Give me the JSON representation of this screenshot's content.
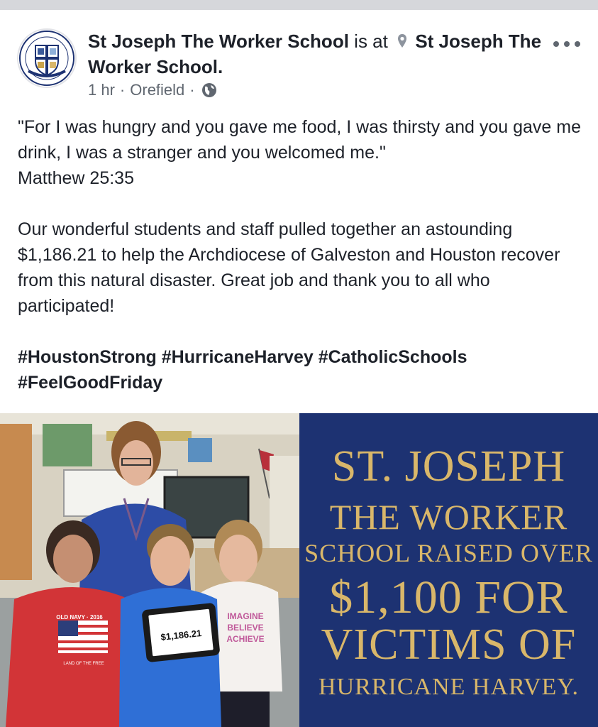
{
  "post": {
    "page_name": "St Joseph The Worker School",
    "checkin_text": "is at",
    "location_name": "St Joseph The Worker School.",
    "time": "1 hr",
    "place": "Orefield",
    "separator": "·",
    "body": {
      "quote": "\"For I was hungry and you gave me food, I was thirsty and you gave me drink, I was a stranger and you welcomed me.\"",
      "citation": "Matthew 25:35",
      "paragraph": "Our wonderful students and staff pulled together an astounding $1,186.21 to help the Archdiocese of Galveston and Houston recover from this natural disaster. Great job and thank you to all who participated!",
      "hashtags": "#HoustonStrong #HurricaneHarvey #CatholicSchools #FeelGoodFriday"
    },
    "icons": {
      "avatar": "school-crest",
      "location": "map-pin-icon",
      "privacy": "globe-icon",
      "menu": "more-options-icon"
    }
  },
  "photo": {
    "tablet_amount": "$1,186.21",
    "shirt_text_left": "OLD NAVY · 2016",
    "shirt_text_left_bottom": "LAND OF THE FREE",
    "shirt_text_right": [
      "IMAGINE",
      "BELIEVE",
      "ACHIEVE"
    ],
    "graphic_lines": [
      "ST. JOSEPH",
      "THE WORKER",
      "SCHOOL RAISED OVER",
      "$1,100 FOR",
      "VICTIMS OF",
      "HURRICANE HARVEY."
    ]
  },
  "colors": {
    "text": "#1d2129",
    "meta": "#606770",
    "graphic_bg": "#1d3272",
    "graphic_text": "#d9b76a"
  }
}
